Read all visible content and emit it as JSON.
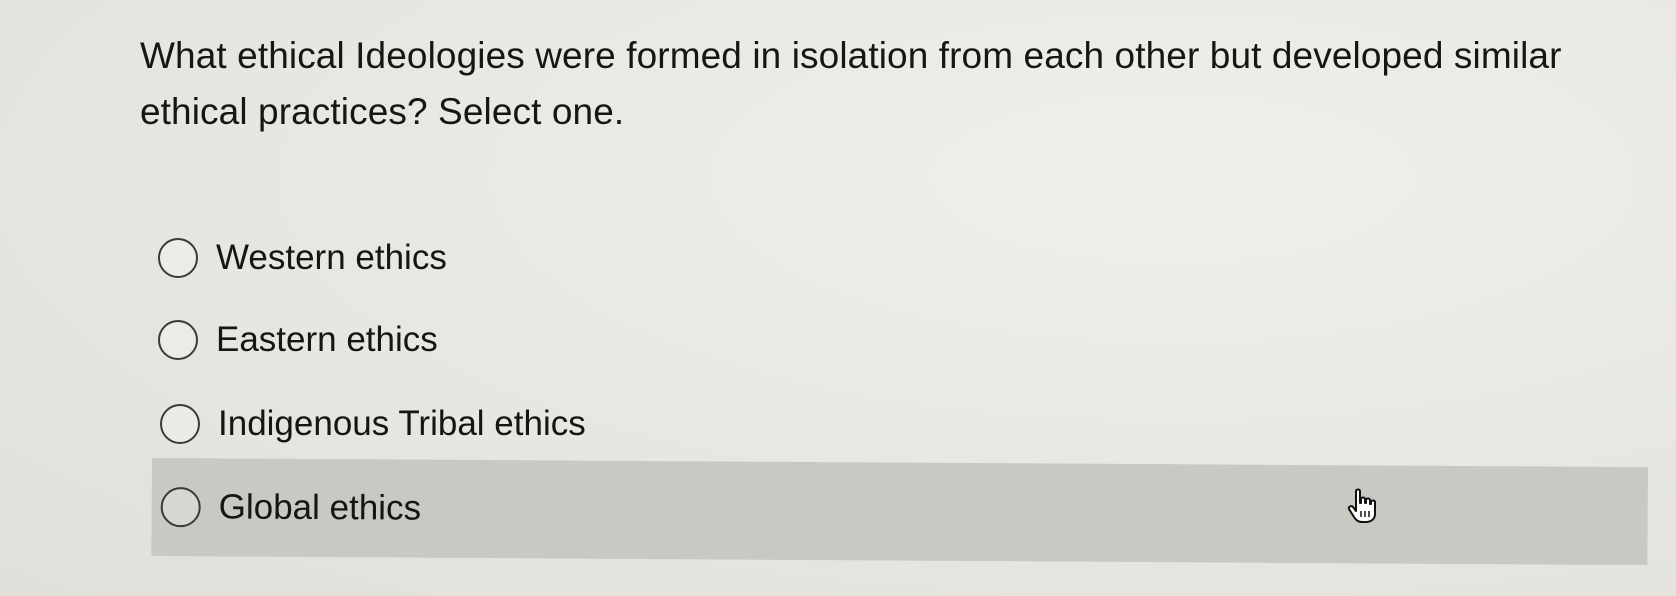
{
  "question": {
    "text": "What ethical Ideologies were formed in isolation from each other but developed similar ethical practices? Select one."
  },
  "options": [
    {
      "label": "Western ethics",
      "selected": false,
      "hovered": false
    },
    {
      "label": "Eastern ethics",
      "selected": false,
      "hovered": false
    },
    {
      "label": "Indigenous Tribal ethics",
      "selected": false,
      "hovered": false
    },
    {
      "label": "Global ethics",
      "selected": false,
      "hovered": true
    }
  ],
  "colors": {
    "background": "#e9e8e2",
    "hover_highlight": "#c9c8c3",
    "text": "#151515"
  },
  "cursor": {
    "icon": "hand-pointer-icon"
  }
}
